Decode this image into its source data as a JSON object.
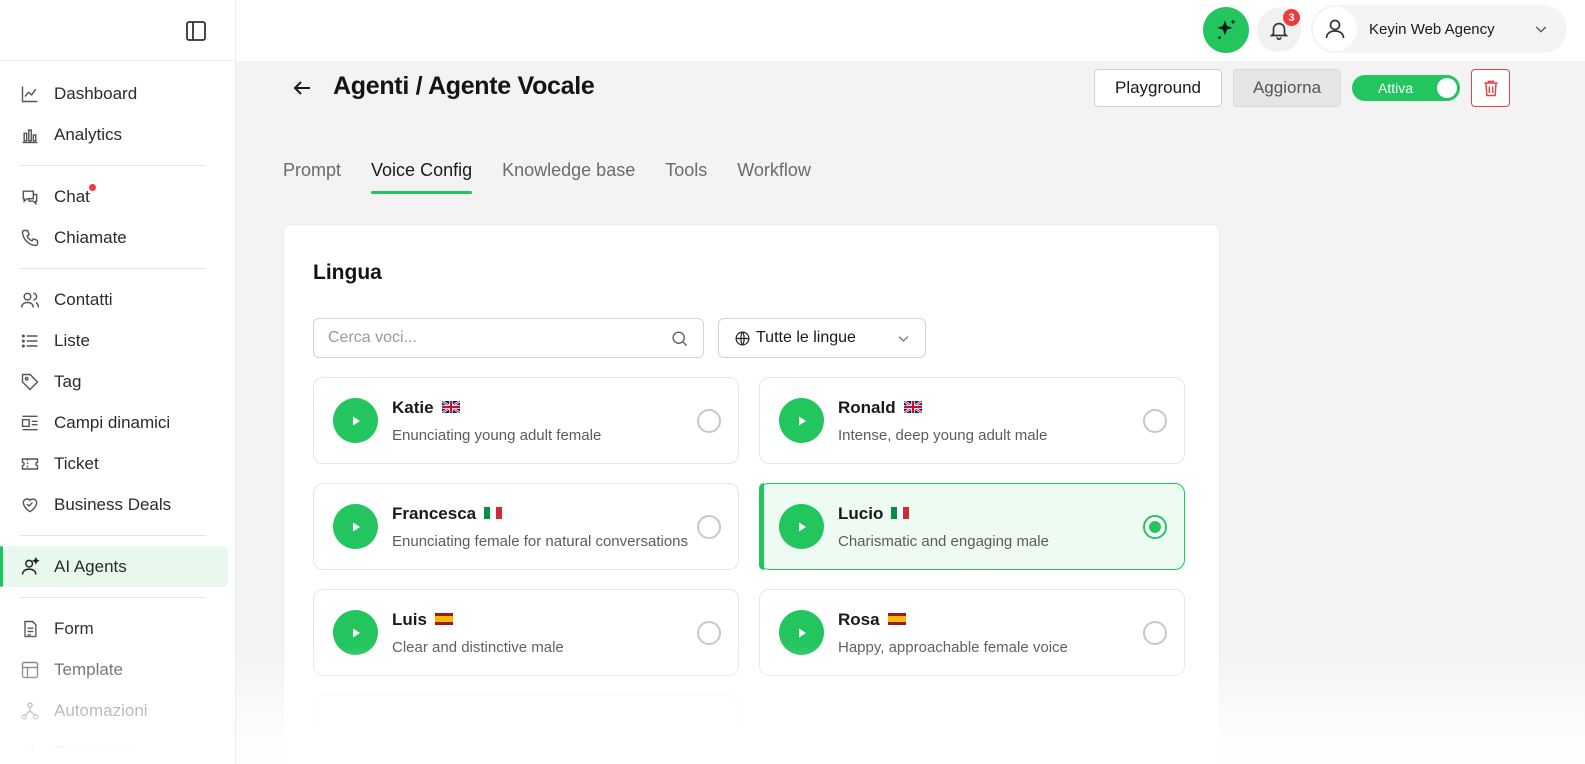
{
  "sidebar": {
    "toggle_icon": "sidebar-toggle-icon",
    "groups": [
      [
        {
          "label": "Dashboard",
          "icon": "line-chart-icon"
        },
        {
          "label": "Analytics",
          "icon": "bar-chart-icon"
        }
      ],
      [
        {
          "label": "Chat",
          "icon": "chat-icon",
          "notification_dot": true
        },
        {
          "label": "Chiamate",
          "icon": "phone-icon"
        }
      ],
      [
        {
          "label": "Contatti",
          "icon": "users-icon"
        },
        {
          "label": "Liste",
          "icon": "list-icon"
        },
        {
          "label": "Tag",
          "icon": "tag-icon"
        },
        {
          "label": "Campi dinamici",
          "icon": "fields-icon"
        },
        {
          "label": "Ticket",
          "icon": "ticket-icon"
        },
        {
          "label": "Business Deals",
          "icon": "handshake-heart-icon"
        }
      ],
      [
        {
          "label": "AI Agents",
          "icon": "ai-agent-icon",
          "active": true
        }
      ],
      [
        {
          "label": "Form",
          "icon": "form-icon"
        },
        {
          "label": "Template",
          "icon": "template-icon"
        },
        {
          "label": "Automazioni",
          "icon": "automation-icon"
        },
        {
          "label": "Campagne",
          "icon": "campaign-icon"
        }
      ]
    ]
  },
  "topbar": {
    "ai_button_icon": "sparkle-icon",
    "notifications_count": "3",
    "account_name": "Keyin Web Agency"
  },
  "header": {
    "title": "Agenti / Agente Vocale",
    "playground_label": "Playground",
    "update_label": "Aggiorna",
    "toggle_label": "Attiva",
    "toggle_on": true
  },
  "tabs": [
    {
      "label": "Prompt",
      "active": false
    },
    {
      "label": "Voice Config",
      "active": true
    },
    {
      "label": "Knowledge base",
      "active": false
    },
    {
      "label": "Tools",
      "active": false
    },
    {
      "label": "Workflow",
      "active": false
    }
  ],
  "language_section": {
    "title": "Lingua",
    "search_placeholder": "Cerca voci...",
    "language_filter": "Tutte le lingue"
  },
  "voices": [
    {
      "name": "Katie",
      "flag": "uk",
      "description": "Enunciating young adult female",
      "selected": false
    },
    {
      "name": "Ronald",
      "flag": "uk",
      "description": "Intense, deep young adult male",
      "selected": false
    },
    {
      "name": "Francesca",
      "flag": "it",
      "description": "Enunciating female for natural conversations",
      "selected": false
    },
    {
      "name": "Lucio",
      "flag": "it",
      "description": "Charismatic and engaging male",
      "selected": true
    },
    {
      "name": "Luis",
      "flag": "es",
      "description": "Clear and distinctive male",
      "selected": false
    },
    {
      "name": "Rosa",
      "flag": "es",
      "description": "Happy, approachable female voice",
      "selected": false
    }
  ],
  "colors": {
    "accent": "#22c55e",
    "danger": "#e04848",
    "badge": "#ef3b3b"
  }
}
